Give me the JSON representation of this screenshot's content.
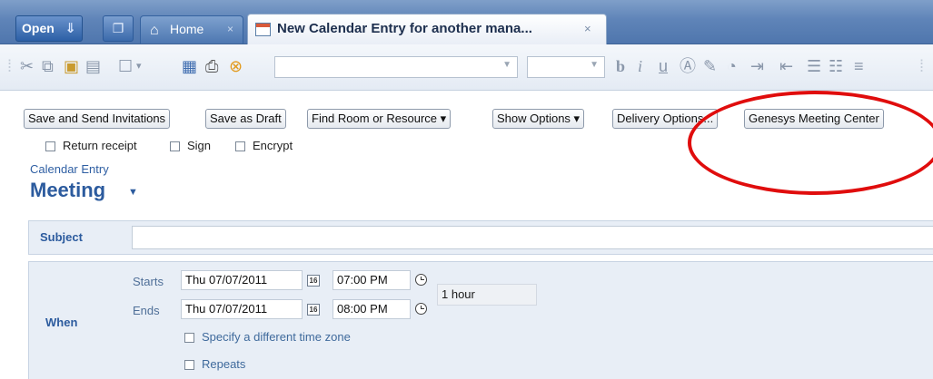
{
  "tabs": {
    "open_label": "Open",
    "home_label": "Home",
    "home_close": "×",
    "entry_label": "New Calendar Entry for another mana...",
    "entry_close": "×"
  },
  "toolbar": {
    "font_name": "",
    "font_size": "",
    "icons": [
      "cut-icon",
      "copy-icon",
      "paste-icon",
      "paste-special-icon",
      "new-icon",
      "save-icon",
      "print-icon",
      "cancel-icon",
      "bold-icon",
      "italic-icon",
      "underline-icon",
      "text-color-icon",
      "highlight-icon",
      "indent-icon",
      "outdent-icon",
      "bullet-list-icon",
      "numbered-list-icon",
      "align-icon"
    ],
    "bold": "b",
    "italic": "i",
    "underline": "u"
  },
  "actions": {
    "save_send": "Save and Send Invitations",
    "save_draft": "Save as Draft",
    "find_room": "Find Room or Resource ▾",
    "show_options": "Show Options ▾",
    "delivery_options": "Delivery Options...",
    "genesys": "Genesys Meeting Center"
  },
  "options": {
    "return_receipt": "Return receipt",
    "sign": "Sign",
    "encrypt": "Encrypt"
  },
  "header": {
    "entry_type": "Calendar Entry",
    "meeting": "Meeting"
  },
  "form": {
    "subject_label": "Subject",
    "subject_value": "",
    "when_label": "When",
    "starts_label": "Starts",
    "ends_label": "Ends",
    "start_date": "Thu 07/07/2011",
    "start_time": "07:00 PM",
    "end_date": "Thu 07/07/2011",
    "end_time": "08:00 PM",
    "calendar_icon_text": "16",
    "duration": "1 hour",
    "timezone_label": "Specify a different time zone",
    "repeats_label": "Repeats"
  },
  "colors": {
    "accent": "#2c5b9e",
    "highlight_ring": "#e00d0d"
  }
}
